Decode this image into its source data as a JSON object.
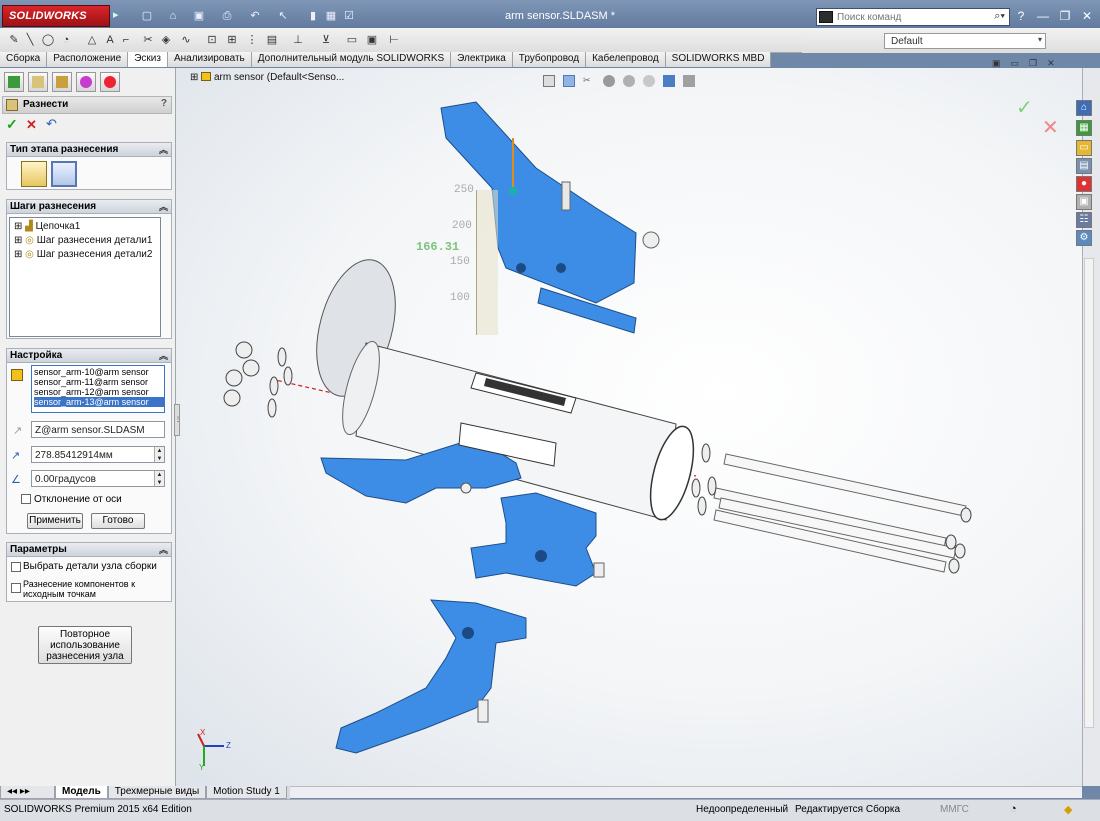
{
  "titlebar": {
    "brand": "SOLIDWORKS",
    "document_title": "arm sensor.SLDASM *",
    "search_placeholder": "Поиск команд",
    "help_icon": "?",
    "minimize": "—",
    "restore": "❐",
    "close": "✕"
  },
  "tabs": [
    "Сборка",
    "Расположение",
    "Эскиз",
    "Анализировать",
    "Дополнительный модуль SOLIDWORKS",
    "Электрика",
    "Трубопровод",
    "Кабелепровод",
    "SOLIDWORKS MBD"
  ],
  "active_tab": "Эскиз",
  "config": {
    "value": "Default"
  },
  "tree_root": "arm sensor  (Default<Senso...",
  "property_manager": {
    "title": "Разнести",
    "explode_type": {
      "header": "Тип этапа разнесения"
    },
    "steps": {
      "header": "Шаги разнесения",
      "items": [
        "Цепочка1",
        "Шаг разнесения детали1",
        "Шаг разнесения детали2"
      ]
    },
    "settings": {
      "header": "Настройка",
      "components": [
        "sensor_arm-10@arm sensor",
        "sensor_arm-11@arm sensor",
        "sensor_arm-12@arm sensor",
        "sensor_arm-13@arm sensor"
      ],
      "direction": "Z@arm sensor.SLDASM",
      "distance": "278.85412914мм",
      "angle": "0.00градусов",
      "rotate_about_axis": "Отклонение от оси",
      "apply": "Применить",
      "done": "Готово"
    },
    "params": {
      "header": "Параметры",
      "select_subassembly": "Выбрать детали узла сборки",
      "explode_from_origin": "Разнесение компонентов к исходным точкам"
    },
    "reuse": "Повторное использование разнесения узла"
  },
  "ruler": {
    "ticks": [
      "250",
      "200",
      "150",
      "100"
    ],
    "readout": "166.31"
  },
  "triad": {
    "x": "X",
    "y": "Y",
    "z": "Z"
  },
  "bottom_tabs": [
    "Модель",
    "Трехмерные виды",
    "Motion Study 1"
  ],
  "active_bottom_tab": "Модель",
  "status": {
    "edition": "SOLIDWORKS Premium 2015 x64 Edition",
    "definition": "Недоопределенный",
    "editing": "Редактируется Сборка",
    "units": "ММГС"
  },
  "colors": {
    "part_blue": "#3d8de6",
    "ok_green": "#1aa31a",
    "cancel_red": "#cc2222"
  }
}
